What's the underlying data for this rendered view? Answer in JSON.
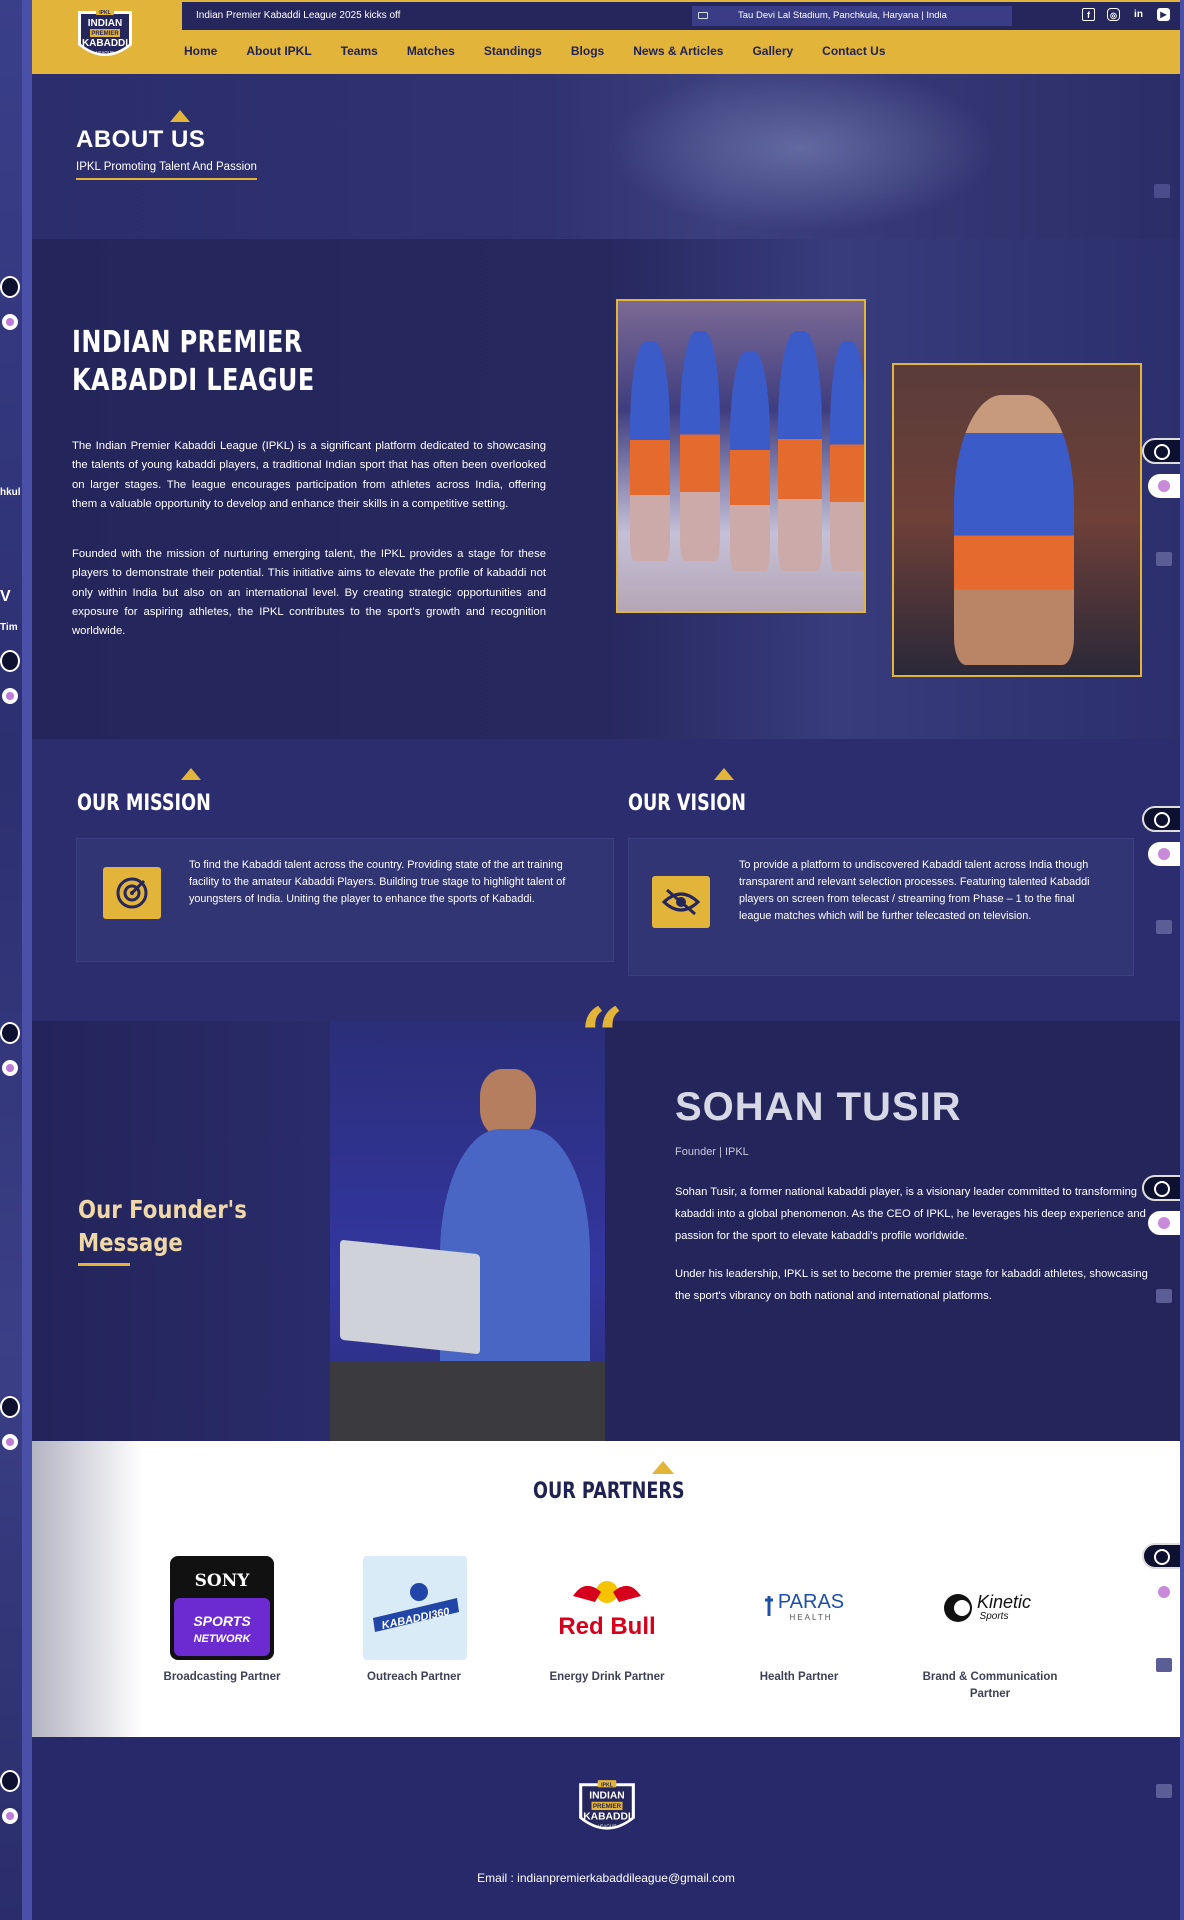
{
  "topbar": {
    "announcement": "Indian Premier Kabaddi League 2025 kicks off",
    "location": "Tau Devi Lal Stadium, Panchkula, Haryana | India",
    "logo_text": [
      "IPKL",
      "INDIAN",
      "PREMIER",
      "KABADDI",
      "LEAGUE"
    ],
    "social_icons": [
      "facebook-icon",
      "instagram-icon",
      "linkedin-icon",
      "youtube-icon"
    ]
  },
  "nav": [
    "Home",
    "About IPKL",
    "Teams",
    "Matches",
    "Standings",
    "Blogs",
    "News & Articles",
    "Gallery",
    "Contact Us"
  ],
  "hero": {
    "title": "ABOUT US",
    "subtitle": "IPKL Promoting Talent And Passion"
  },
  "league": {
    "title_line1": "INDIAN PREMIER",
    "title_line2": "KABADDI LEAGUE",
    "para1": "The Indian Premier Kabaddi League (IPKL) is a significant platform dedicated to showcasing the talents of young kabaddi players, a traditional Indian sport that has often been overlooked on larger stages. The league encourages participation from athletes across India, offering them a valuable opportunity to develop and enhance their skills in a competitive setting.",
    "para2": "Founded with the mission of nurturing emerging talent, the IPKL provides a stage for these players to demonstrate their potential. This initiative aims to elevate the profile of kabaddi not only within India but also on an international level. By creating strategic opportunities and exposure for aspiring athletes, the IPKL contributes to the sport's growth and recognition worldwide."
  },
  "mission": {
    "title": "OUR MISSION",
    "text": "To find the Kabaddi talent across the country. Providing state of the art training facility to the amateur Kabaddi Players. Building true stage to highlight talent of youngsters of India. Uniting the player to enhance the sports of Kabaddi."
  },
  "vision": {
    "title": "OUR VISION",
    "text": "To provide a platform to undiscovered Kabaddi talent across India though transparent and relevant selection processes. Featuring talented Kabaddi players on screen from telecast / streaming from Phase – 1 to the final league matches which will be further telecasted on television."
  },
  "founder": {
    "section_line1": "Our Founder's",
    "section_line2": "Message",
    "name": "SOHAN TUSIR",
    "role": "Founder | IPKL",
    "para1": "Sohan Tusir, a former national kabaddi player, is a visionary leader committed to transforming kabaddi into a global phenomenon. As the CEO of IPKL, he leverages his deep experience and passion for the sport to elevate kabaddi's profile worldwide.",
    "para2": "Under his leadership, IPKL is set to become the premier stage for kabaddi athletes, showcasing the sport's vibrancy on both national and international platforms."
  },
  "partners": {
    "title": "OUR PARTNERS",
    "items": [
      {
        "logo_lines": [
          "SONY",
          "SPORTS",
          "NETWORK"
        ],
        "caption": "Broadcasting Partner"
      },
      {
        "logo_lines": [
          "KABADDI360"
        ],
        "caption": "Outreach Partner"
      },
      {
        "logo_lines": [
          "Red Bull"
        ],
        "caption": "Energy Drink Partner"
      },
      {
        "logo_lines": [
          "PARAS",
          "HEALTH"
        ],
        "caption": "Health Partner"
      },
      {
        "logo_lines": [
          "Kinetic",
          "Sports"
        ],
        "caption": "Brand & Communication Partner"
      }
    ]
  },
  "footer": {
    "email": "Email : indianpremierkabaddileague@gmail.com"
  },
  "sidebar_peek": {
    "texts": [
      "hkul",
      "V",
      "Tim"
    ]
  },
  "colors": {
    "accent": "#e2b53a",
    "navy": "#25265c",
    "card": "#313574"
  }
}
